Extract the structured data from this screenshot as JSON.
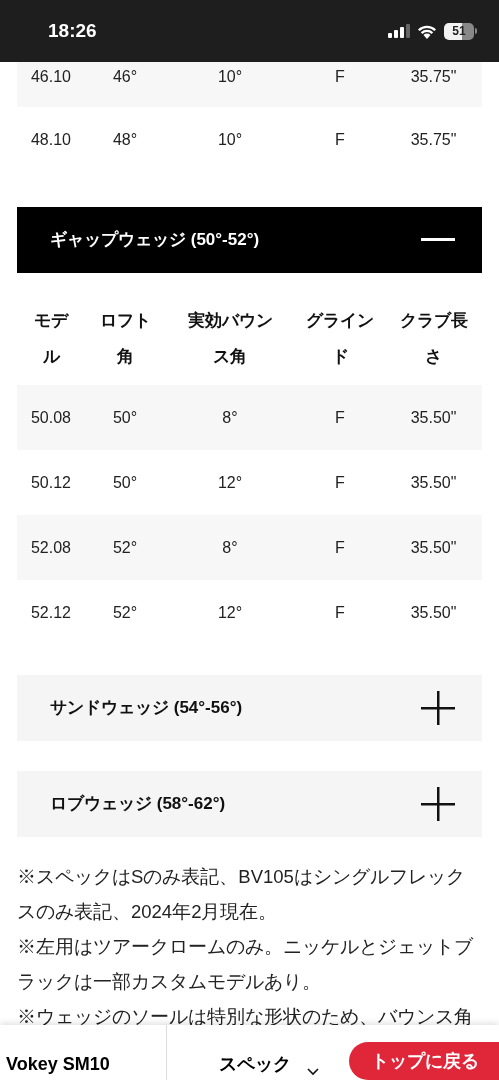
{
  "status_bar": {
    "time": "18:26",
    "battery": "51"
  },
  "previous_rows": [
    [
      "46.10",
      "46°",
      "10°",
      "F",
      "35.75\""
    ],
    [
      "48.10",
      "48°",
      "10°",
      "F",
      "35.75\""
    ]
  ],
  "sections": [
    {
      "title": "ギャップウェッジ (50°-52°)",
      "expanded": true,
      "columns": [
        "モデル",
        "ロフト角",
        "実効バウンス角",
        "グラインド",
        "クラブ長さ"
      ],
      "rows": [
        [
          "50.08",
          "50°",
          "8°",
          "F",
          "35.50\""
        ],
        [
          "50.12",
          "50°",
          "12°",
          "F",
          "35.50\""
        ],
        [
          "52.08",
          "52°",
          "8°",
          "F",
          "35.50\""
        ],
        [
          "52.12",
          "52°",
          "12°",
          "F",
          "35.50\""
        ]
      ]
    },
    {
      "title": "サンドウェッジ (54°-56°)",
      "expanded": false
    },
    {
      "title": "ロブウェッジ (58°-62°)",
      "expanded": false
    }
  ],
  "notes": [
    "※スペックはSのみ表記、BV105はシングルフレックスのみ表記、2024年2月現在。",
    "※左用はツアークロームのみ。ニッケルとジェットブラックは一部カスタムモデルあり。",
    "※ウェッジのソールは特別な形状のため、バウンス角"
  ],
  "bottom_nav": {
    "product": "Vokey SM10",
    "menu": "スペック",
    "back_to_top": "トップに戻る"
  }
}
